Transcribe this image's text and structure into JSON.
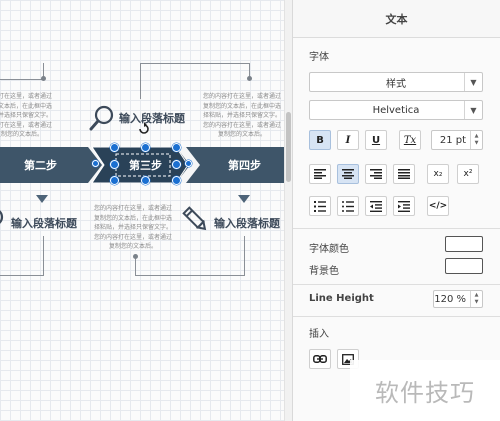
{
  "canvas": {
    "body_text": "您的内容打在这里，或者通过\n复制您的文本后，在此框中选\n择粘贴，并选择只保留文字。\n您的内容打在这里，或者通过\n复制您的文本后。",
    "body_text_short": "内容打在这里，或者通过\n您的文本后，在此框中选\n贴，并选择只保留文字。\n内容打在这里，或者通过\n复制您的文本后。",
    "body_text_left_bottom": "的文本后，在此框中选\n贴，并选择只保留文字。\n内容打在这里，或者通过\n复制您的文本后。",
    "heading": "输入段落标题",
    "heading_partial": "输入段落标题",
    "steps": {
      "step2": "第二步",
      "step3": "第三步",
      "step4": "第四步"
    },
    "colors": {
      "band": "#3e5569",
      "selection": "#1a6fd1"
    },
    "icons": [
      "magnifier-icon",
      "pencil-icon",
      "rotate-handle-icon"
    ]
  },
  "panel": {
    "title": "文本",
    "font_section": "字体",
    "style_select": "样式",
    "font_select": "Helvetica",
    "font_size": "21 pt",
    "format_buttons": {
      "bold": "B",
      "italic": "I",
      "underline": "U",
      "clear": "Tx"
    },
    "subscript": "x₂",
    "superscript": "x²",
    "html_button": "</>",
    "font_color_label": "字体颜色",
    "background_label": "背景色",
    "line_height_label": "Line Height",
    "line_height_value": "120 %",
    "insert_label": "插入"
  },
  "watermark": "软件技巧"
}
